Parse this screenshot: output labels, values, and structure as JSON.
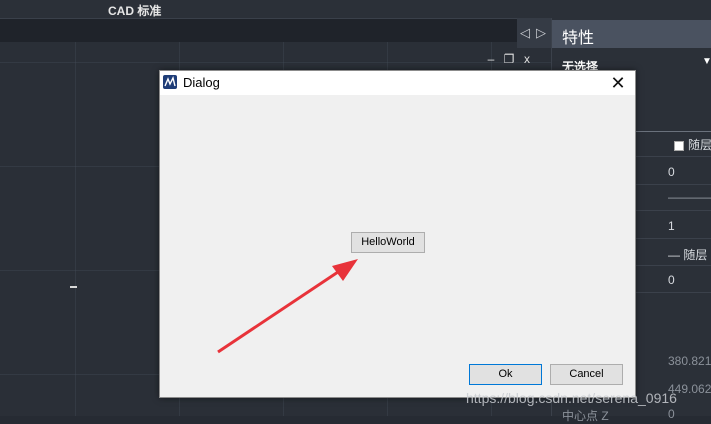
{
  "topbar": {
    "title": "CAD 标准"
  },
  "viewport": {
    "minimize": "–",
    "restore": "❐",
    "close": "x"
  },
  "panel": {
    "arrows": {
      "left": "◁",
      "right": "▷"
    },
    "title": "特性",
    "selection": "无选择",
    "rows": [
      {
        "value": "随层",
        "checkbox": true
      },
      {
        "value": "0"
      },
      {
        "value": "——————"
      },
      {
        "value": "1"
      },
      {
        "value": "— 随层"
      },
      {
        "value": "0"
      }
    ],
    "geom_values": [
      "380.821",
      "449.062"
    ],
    "center_label": "中心点 Z",
    "center_value": "0"
  },
  "dialog": {
    "title": "Dialog",
    "close_glyph": "✕",
    "hello_label": "HelloWorld",
    "ok_label": "Ok",
    "cancel_label": "Cancel"
  },
  "watermark": "https://blog.csdn.net/serena_0916",
  "colors": {
    "accent": "#0078d7",
    "arrow": "#e8333a",
    "app_bg": "#2a2f37"
  }
}
